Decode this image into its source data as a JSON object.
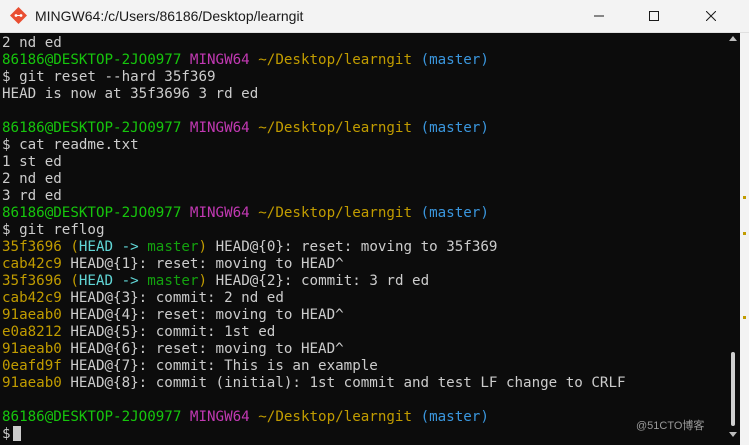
{
  "window": {
    "title": "MINGW64:/c/Users/86186/Desktop/learngit"
  },
  "terminal": {
    "prompt": {
      "user": "86186@DESKTOP-2JO0977",
      "system": "MINGW64",
      "path": "~/Desktop/learngit",
      "branch": "(master)"
    },
    "lines": {
      "l0": "2 nd ed",
      "l2": "$ git reset --hard 35f369",
      "l3": "HEAD is now at 35f3696 3 rd ed",
      "l6": "$ cat readme.txt",
      "l7": "1 st ed",
      "l8": "2 nd ed",
      "l9": "3 rd ed",
      "l11": "$ git reflog",
      "l24": "$"
    },
    "reflog": [
      {
        "hash": "35f3696",
        "decoration": true,
        "rest": " HEAD@{0}: reset: moving to 35f369"
      },
      {
        "hash": "cab42c9",
        "decoration": false,
        "rest": " HEAD@{1}: reset: moving to HEAD^"
      },
      {
        "hash": "35f3696",
        "decoration": true,
        "rest": " HEAD@{2}: commit: 3 rd ed"
      },
      {
        "hash": "cab42c9",
        "decoration": false,
        "rest": " HEAD@{3}: commit: 2 nd ed"
      },
      {
        "hash": "91aeab0",
        "decoration": false,
        "rest": " HEAD@{4}: reset: moving to HEAD^"
      },
      {
        "hash": "e0a8212",
        "decoration": false,
        "rest": " HEAD@{5}: commit: 1st ed"
      },
      {
        "hash": "91aeab0",
        "decoration": false,
        "rest": " HEAD@{6}: reset: moving to HEAD^"
      },
      {
        "hash": "0eafd9f",
        "decoration": false,
        "rest": " HEAD@{7}: commit: This is an example"
      },
      {
        "hash": "91aeab0",
        "decoration": false,
        "rest": " HEAD@{8}: commit (initial): 1st commit and test LF change to CRLF"
      }
    ],
    "decoration": {
      "open": "(",
      "head": "HEAD",
      "arrow": " -> ",
      "branch": "master",
      "close": ")"
    }
  },
  "watermark": "@51CTO博客"
}
